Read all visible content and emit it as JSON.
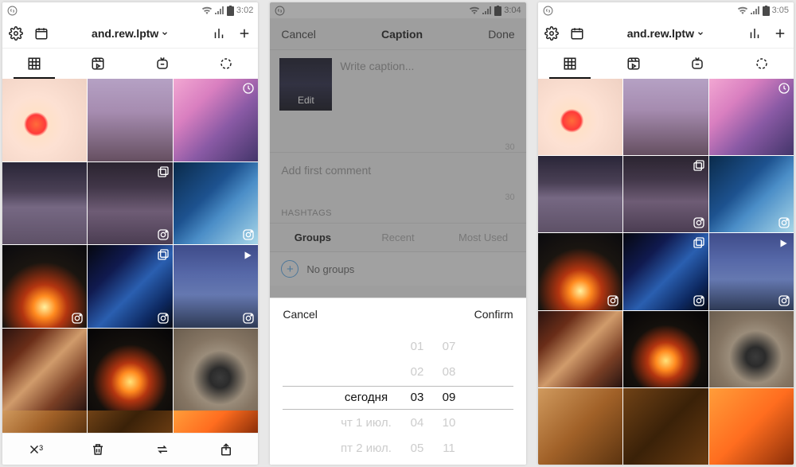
{
  "status": {
    "time_a": "3:02",
    "time_b": "3:04",
    "time_c": "3:05"
  },
  "header": {
    "username": "and.rew.lptw"
  },
  "bottom": {
    "close_count": "3"
  },
  "caption": {
    "cancel": "Cancel",
    "title": "Caption",
    "done": "Done",
    "edit": "Edit",
    "placeholder": "Write caption...",
    "counter1": "30",
    "add_comment": "Add first comment",
    "counter2": "30",
    "section": "HASHTAGS",
    "tabs": {
      "groups": "Groups",
      "recent": "Recent",
      "most": "Most Used"
    },
    "no_groups": "No groups"
  },
  "picker": {
    "cancel": "Cancel",
    "confirm": "Confirm",
    "date": {
      "above2": "",
      "above1": "",
      "sel": "сегодня",
      "below1": "чт 1 июл.",
      "below2": "пт 2 июл."
    },
    "hour": {
      "above2": "01",
      "above1": "02",
      "sel": "03",
      "below1": "04",
      "below2": "05"
    },
    "min": {
      "above2": "07",
      "above1": "08",
      "sel": "09",
      "below1": "10",
      "below2": "11"
    }
  }
}
